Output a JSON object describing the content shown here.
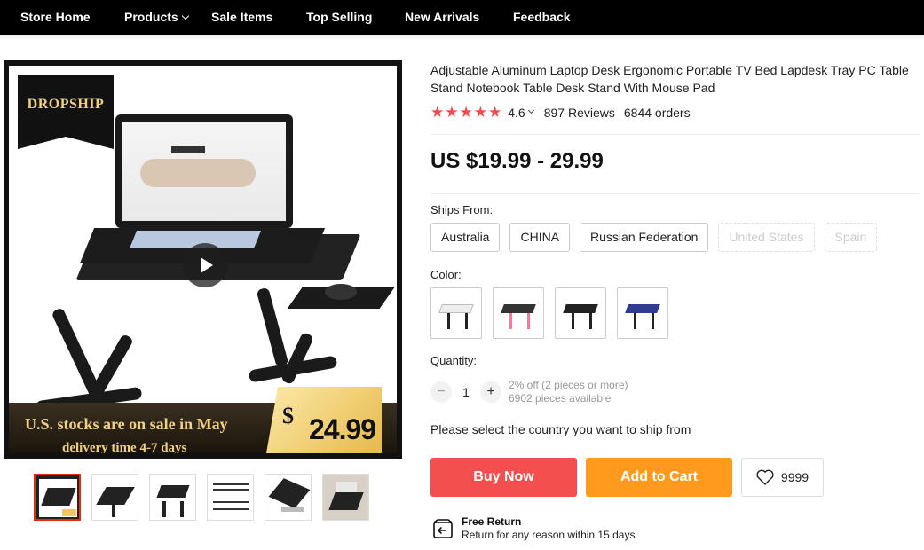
{
  "nav": {
    "items": [
      {
        "label": "Store Home"
      },
      {
        "label": "Products",
        "has_dropdown": true
      },
      {
        "label": "Sale Items"
      },
      {
        "label": "Top Selling"
      },
      {
        "label": "New Arrivals"
      },
      {
        "label": "Feedback"
      }
    ]
  },
  "gallery": {
    "badge": "DROPSHIP",
    "promo_line1": "U.S. stocks are on sale in May",
    "promo_line2": "delivery time 4-7 days",
    "price_dollar": "$",
    "price_amount": "24.99",
    "thumbnail_count": 6,
    "active_thumbnail": 1
  },
  "product": {
    "title": "Adjustable Aluminum Laptop Desk Ergonomic Portable TV Bed Lapdesk Tray PC Table Stand Notebook Table Desk Stand With Mouse Pad",
    "rating": "4.6",
    "reviews": "897 Reviews",
    "orders": "6844 orders",
    "price": "US $19.99 - 29.99"
  },
  "ships_from": {
    "label": "Ships From:",
    "options": [
      {
        "label": "Australia",
        "available": true
      },
      {
        "label": "CHINA",
        "available": true
      },
      {
        "label": "Russian Federation",
        "available": true
      },
      {
        "label": "United States",
        "available": false
      },
      {
        "label": "Spain",
        "available": false
      }
    ]
  },
  "color": {
    "label": "Color:",
    "options": [
      {
        "name": "white-desk-icon",
        "top": "#f4f4f4",
        "leg": "#222"
      },
      {
        "name": "pink-desk-icon",
        "top": "#333",
        "leg": "#f47a9a"
      },
      {
        "name": "black-desk-icon",
        "top": "#222",
        "leg": "#222"
      },
      {
        "name": "blue-desk-icon",
        "top": "#2f3c8f",
        "leg": "#222"
      }
    ]
  },
  "quantity": {
    "label": "Quantity:",
    "value": "1",
    "discount": "2% off (2 pieces or more)",
    "available": "6902 pieces available"
  },
  "ship_message": "Please select the country you want to ship from",
  "actions": {
    "buy_now": "Buy Now",
    "add_to_cart": "Add to Cart",
    "wishlist_count": "9999"
  },
  "free_return": {
    "title": "Free Return",
    "subtitle": "Return for any reason within 15 days"
  },
  "colors": {
    "star": "#f24a4a",
    "buy": "#f44f4f",
    "cart": "#ff9a1f"
  }
}
